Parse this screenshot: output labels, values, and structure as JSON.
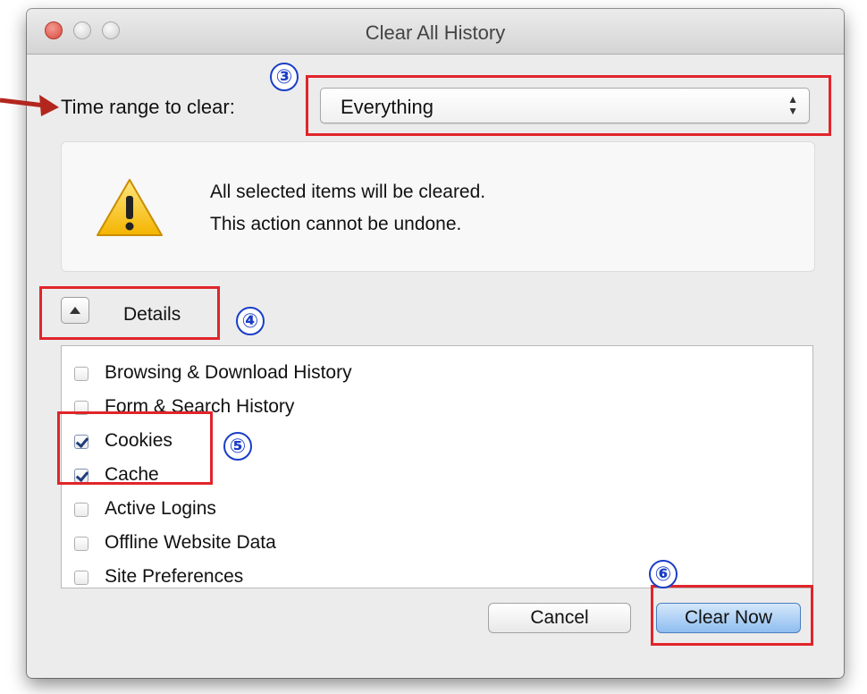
{
  "window": {
    "title": "Clear All History"
  },
  "time_range": {
    "label": "Time range to clear:",
    "value": "Everything"
  },
  "warning": {
    "line1": "All selected items will be cleared.",
    "line2": "This action cannot be undone."
  },
  "details": {
    "label": "Details"
  },
  "items": [
    {
      "label": "Browsing & Download History",
      "checked": false
    },
    {
      "label": "Form & Search History",
      "checked": false
    },
    {
      "label": "Cookies",
      "checked": true
    },
    {
      "label": "Cache",
      "checked": true
    },
    {
      "label": "Active Logins",
      "checked": false
    },
    {
      "label": "Offline Website Data",
      "checked": false
    },
    {
      "label": "Site Preferences",
      "checked": false
    }
  ],
  "buttons": {
    "cancel": "Cancel",
    "clear_now": "Clear Now"
  },
  "annotations": {
    "step3": "③",
    "step4": "④",
    "step5": "⑤",
    "step6": "⑥"
  },
  "colors": {
    "highlight": "#e0252b",
    "step_marker": "#1a3ec7",
    "arrow": "#b3261e",
    "default_button": "#8ebdf0"
  }
}
